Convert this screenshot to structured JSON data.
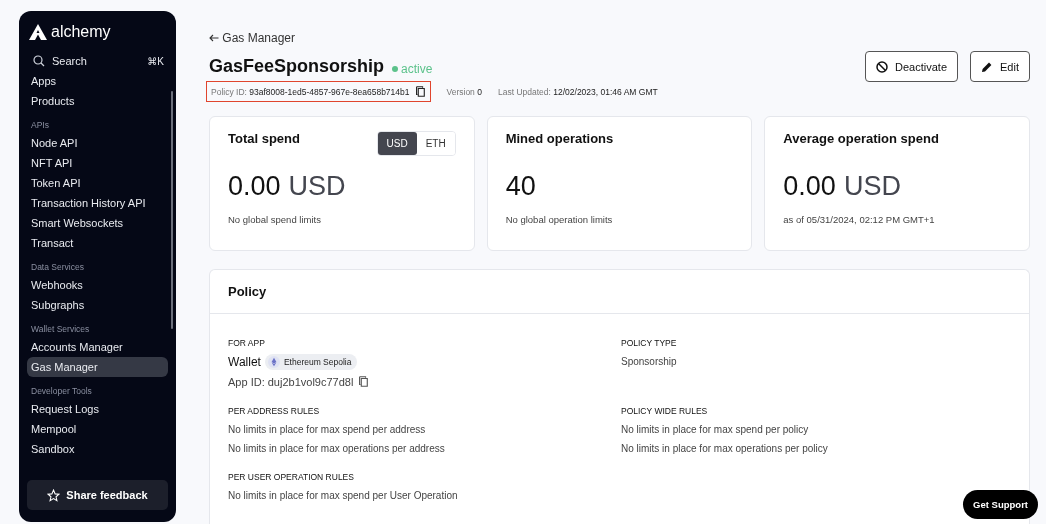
{
  "sidebar": {
    "brand": "alchemy",
    "search": {
      "placeholder": "Search",
      "shortcut": "⌘K"
    },
    "nav": [
      {
        "kind": "item",
        "label": "Apps",
        "selected": false
      },
      {
        "kind": "item",
        "label": "Products",
        "selected": false
      },
      {
        "kind": "heading",
        "label": "APIs"
      },
      {
        "kind": "item",
        "label": "Node API",
        "selected": false
      },
      {
        "kind": "item",
        "label": "NFT API",
        "selected": false
      },
      {
        "kind": "item",
        "label": "Token API",
        "selected": false
      },
      {
        "kind": "item",
        "label": "Transaction History API",
        "selected": false
      },
      {
        "kind": "item",
        "label": "Smart Websockets",
        "selected": false
      },
      {
        "kind": "item",
        "label": "Transact",
        "selected": false
      },
      {
        "kind": "heading",
        "label": "Data Services"
      },
      {
        "kind": "item",
        "label": "Webhooks",
        "selected": false
      },
      {
        "kind": "item",
        "label": "Subgraphs",
        "selected": false
      },
      {
        "kind": "heading",
        "label": "Wallet Services"
      },
      {
        "kind": "item",
        "label": "Accounts Manager",
        "selected": false
      },
      {
        "kind": "item",
        "label": "Gas Manager",
        "selected": true
      },
      {
        "kind": "heading",
        "label": "Developer Tools"
      },
      {
        "kind": "item",
        "label": "Request Logs",
        "selected": false
      },
      {
        "kind": "item",
        "label": "Mempool",
        "selected": false
      },
      {
        "kind": "item",
        "label": "Sandbox",
        "selected": false
      }
    ],
    "feedback_button": "Share feedback"
  },
  "breadcrumb": "Gas Manager",
  "title": "GasFeeSponsorship",
  "status": "active",
  "policy_id": {
    "label": "Policy ID:",
    "value": "93af8008-1ed5-4857-967e-8ea658b714b1"
  },
  "version": {
    "label": "Version",
    "value": "0"
  },
  "last_updated": {
    "label": "Last Updated:",
    "value": "12/02/2023, 01:46 AM GMT"
  },
  "actions": [
    "Deactivate",
    "Edit"
  ],
  "stats": [
    {
      "title": "Total spend",
      "number": "0.00",
      "unit": "USD",
      "note": "No global spend limits",
      "toggle": [
        {
          "label": "USD",
          "selected": true
        },
        {
          "label": "ETH",
          "selected": false
        }
      ]
    },
    {
      "title": "Mined operations",
      "number": "40",
      "note": "No global operation limits"
    },
    {
      "title": "Average operation spend",
      "number": "0.00",
      "unit": "USD",
      "note": "as of 05/31/2024, 02:12 PM GMT+1"
    }
  ],
  "policy": {
    "heading": "Policy",
    "for_app": {
      "label": "FOR APP",
      "name": "Wallet",
      "network": "Ethereum Sepolia",
      "app_id": "App ID: duj2b1vol9c77d8l"
    },
    "policy_type": {
      "label": "POLICY TYPE",
      "value": "Sponsorship"
    },
    "rule_groups": [
      {
        "label": "PER ADDRESS RULES",
        "lines": [
          "No limits in place for max spend per address",
          "No limits in place for max operations per address"
        ]
      },
      {
        "label": "POLICY WIDE RULES",
        "lines": [
          "No limits in place for max spend per policy",
          "No limits in place for max operations per policy"
        ]
      },
      {
        "label": "PER USER OPERATION RULES",
        "lines": [
          "No limits in place for max spend per User Operation"
        ]
      }
    ]
  },
  "support_button": "Get Support"
}
